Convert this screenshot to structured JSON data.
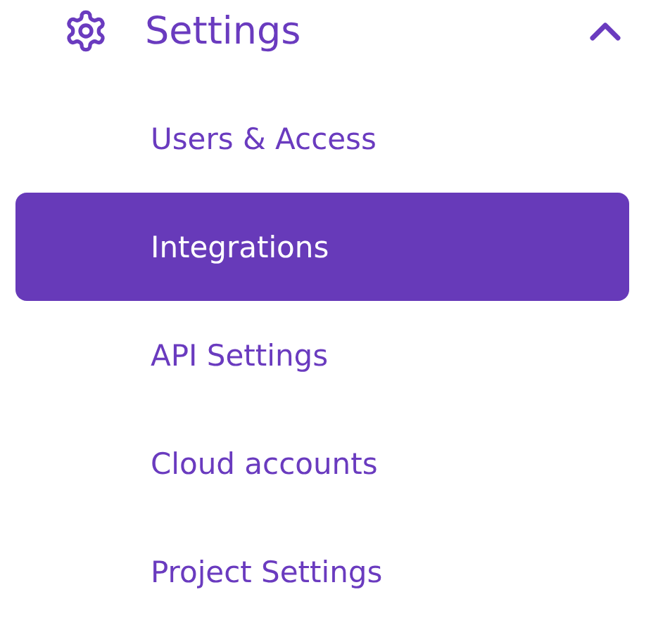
{
  "section": {
    "title": "Settings",
    "expanded": true
  },
  "items": [
    {
      "label": "Users & Access",
      "selected": false
    },
    {
      "label": "Integrations",
      "selected": true
    },
    {
      "label": "API Settings",
      "selected": false
    },
    {
      "label": "Cloud accounts",
      "selected": false
    },
    {
      "label": "Project Settings",
      "selected": false
    }
  ]
}
